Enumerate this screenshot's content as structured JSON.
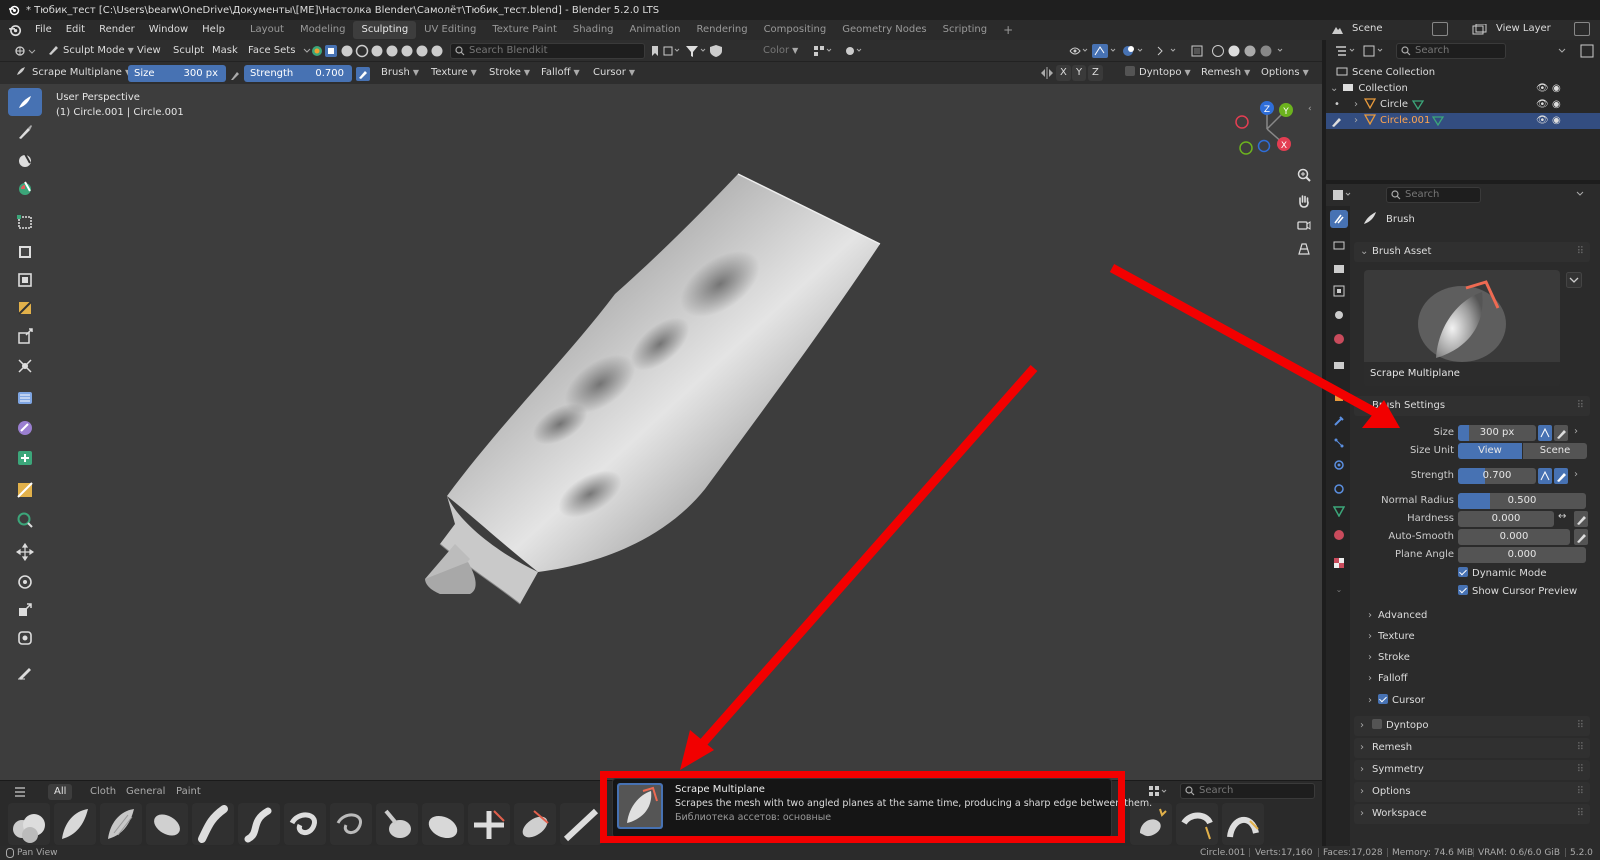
{
  "window_title": "* Тюбик_тест [C:\\Users\\bearw\\OneDrive\\Документы\\[ME]\\Настолка Blender\\Самолёт\\Тюбик_тест.blend] - Blender 5.2.0 LTS",
  "menu": [
    "File",
    "Edit",
    "Render",
    "Window",
    "Help"
  ],
  "workspaces": [
    "Layout",
    "Modeling",
    "Sculpting",
    "UV Editing",
    "Texture Paint",
    "Shading",
    "Animation",
    "Rendering",
    "Compositing",
    "Geometry Nodes",
    "Scripting"
  ],
  "active_workspace": "Sculpting",
  "scene": {
    "name": "Scene",
    "view_layer": "View Layer"
  },
  "header1": {
    "mode": "Sculpt Mode",
    "menus": [
      "View",
      "Sculpt",
      "Mask",
      "Face Sets"
    ],
    "search_placeholder": "Search Blendkit",
    "color_label": "Color"
  },
  "header2": {
    "brush_name": "Scrape Multiplane",
    "size_label": "Size",
    "size_value": "300 px",
    "strength_label": "Strength",
    "strength_value": "0.700",
    "menus": [
      "Brush",
      "Texture",
      "Stroke",
      "Falloff",
      "Cursor"
    ],
    "axes": [
      "X",
      "Y",
      "Z"
    ],
    "dyntopo": "Dyntopo",
    "remesh": "Remesh",
    "options": "Options"
  },
  "viewport": {
    "label": "User Perspective",
    "object": "(1) Circle.001 | Circle.001",
    "gizmo_axes": [
      "Z",
      "Y",
      "X"
    ]
  },
  "outliner": {
    "search_placeholder": "Search",
    "root": "Scene Collection",
    "collection": "Collection",
    "items": [
      "Circle",
      "Circle.001"
    ]
  },
  "properties": {
    "search_placeholder": "Search",
    "context": "Brush",
    "brush_asset_panel": "Brush Asset",
    "brush_asset_name": "Scrape Multiplane",
    "settings_panel": "Brush Settings",
    "size_label": "Size",
    "size_value": "300 px",
    "size_fraction": 0.14,
    "size_unit_label": "Size Unit",
    "size_unit_options": [
      "View",
      "Scene"
    ],
    "strength_label": "Strength",
    "strength_value": "0.700",
    "strength_fraction": 0.35,
    "normal_radius_label": "Normal Radius",
    "normal_radius_value": "0.500",
    "normal_radius_fraction": 0.5,
    "hardness_label": "Hardness",
    "hardness_value": "0.000",
    "auto_smooth_label": "Auto-Smooth",
    "auto_smooth_value": "0.000",
    "plane_angle_label": "Plane Angle",
    "plane_angle_value": "0.000",
    "dynamic_mode": "Dynamic Mode",
    "show_cursor_preview": "Show Cursor Preview",
    "subpanels": [
      "Advanced",
      "Texture",
      "Stroke",
      "Falloff",
      "Cursor"
    ],
    "panels": [
      "Dyntopo",
      "Remesh",
      "Symmetry",
      "Options",
      "Workspace"
    ]
  },
  "asset_shelf": {
    "categories": [
      "All",
      "Cloth",
      "General",
      "Paint"
    ],
    "active_category": "All",
    "search_placeholder": "Search"
  },
  "tooltip": {
    "title": "Scrape Multiplane",
    "description": "Scrapes the mesh with two angled planes at the same time, producing a sharp edge between them.",
    "library": "Библиотека ассетов: основные"
  },
  "status": {
    "left": "Pan View",
    "object": "Circle.001",
    "verts": "Verts:17,160",
    "faces": "Faces:17,028",
    "memory": "Memory: 74.6 MiB",
    "vram": "VRAM: 0.6/6.0 GiB",
    "version": "5.2.0"
  },
  "colors": {
    "accent": "#4772b3",
    "annotation_red": "#f20000",
    "viewport_bg": "#3d3d3d"
  }
}
